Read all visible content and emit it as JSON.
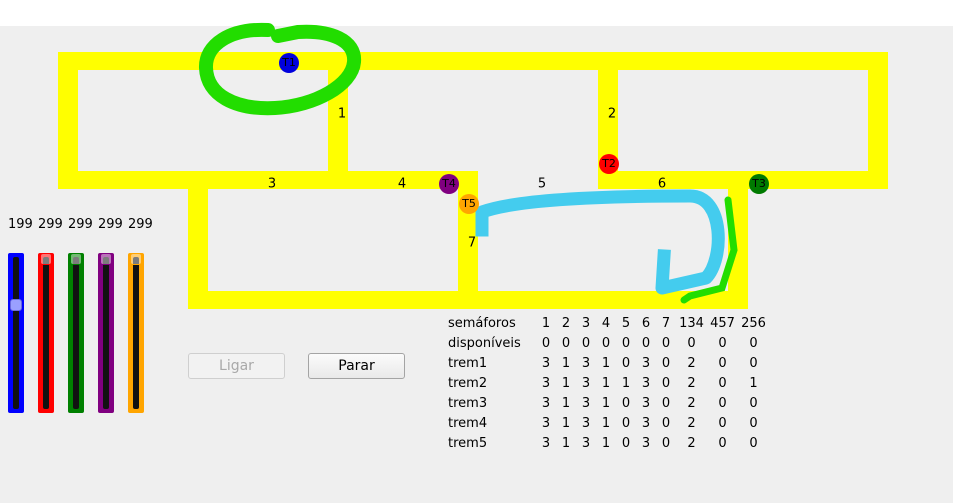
{
  "tracks": {
    "segment_labels": [
      "1",
      "2",
      "3",
      "4",
      "5",
      "6",
      "7"
    ]
  },
  "trains": [
    {
      "id": "T1",
      "color": "#0000dd"
    },
    {
      "id": "T2",
      "color": "#ff0000"
    },
    {
      "id": "T3",
      "color": "#007a00"
    },
    {
      "id": "T4",
      "color": "#800080"
    },
    {
      "id": "T5",
      "color": "#ffa500"
    }
  ],
  "speeds": {
    "values": [
      "199",
      "299",
      "299",
      "299",
      "299"
    ],
    "slider_levels": [
      0.69,
      1.0,
      1.0,
      1.0,
      1.0
    ],
    "colors": [
      "#0000ff",
      "#ff0000",
      "#008000",
      "#800080",
      "#ffa500"
    ]
  },
  "buttons": {
    "ligar": "Ligar",
    "parar": "Parar"
  },
  "semaphores": {
    "header": [
      "semáforos",
      "1",
      "2",
      "3",
      "4",
      "5",
      "6",
      "7",
      "134",
      "457",
      "256"
    ],
    "rows": [
      [
        "disponíveis",
        "0",
        "0",
        "0",
        "0",
        "0",
        "0",
        "0",
        "0",
        "0",
        "0"
      ],
      [
        "trem1",
        "3",
        "1",
        "3",
        "1",
        "0",
        "3",
        "0",
        "2",
        "0",
        "0"
      ],
      [
        "trem2",
        "3",
        "1",
        "3",
        "1",
        "1",
        "3",
        "0",
        "2",
        "0",
        "1"
      ],
      [
        "trem3",
        "3",
        "1",
        "3",
        "1",
        "0",
        "3",
        "0",
        "2",
        "0",
        "0"
      ],
      [
        "trem4",
        "3",
        "1",
        "3",
        "1",
        "0",
        "3",
        "0",
        "2",
        "0",
        "0"
      ],
      [
        "trem5",
        "3",
        "1",
        "3",
        "1",
        "0",
        "3",
        "0",
        "2",
        "0",
        "0"
      ]
    ]
  },
  "annotation_colors": {
    "green_scribble": "#22dd00",
    "blue_scribble": "#44ccee"
  }
}
